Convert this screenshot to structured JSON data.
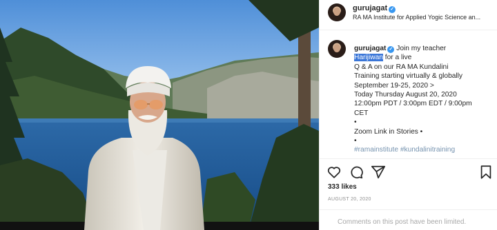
{
  "post": {
    "username": "gurujagat",
    "location": "RA MA Institute for Applied Yogic Science an...",
    "caption": {
      "username": "gurujagat",
      "before_highlight": "Join my teacher",
      "highlight": "Harijiwan",
      "lines": [
        "for a live",
        "Q & A on our RA MA Kundalini",
        "Training starting virtually & globally",
        "September 19-25, 2020 >",
        "Today Thursday August 20, 2020",
        "12:00pm PDT / 3:00pm EDT / 9:00pm",
        "CET",
        "•",
        "Zoom Link in Stories •",
        "•",
        "#ramainstitute #kundalinitraining"
      ]
    },
    "likes": "333 likes",
    "date": "AUGUST 20, 2020",
    "comments_disabled": "Comments on this post have been limited."
  },
  "icons": {
    "like": "heart-icon",
    "comment": "comment-icon",
    "share": "share-icon",
    "save": "bookmark-icon",
    "verified": "verified-badge-icon"
  },
  "colors": {
    "highlight": "#3a76d8",
    "verified": "#3897f0",
    "muted": "#8e8e8e"
  }
}
